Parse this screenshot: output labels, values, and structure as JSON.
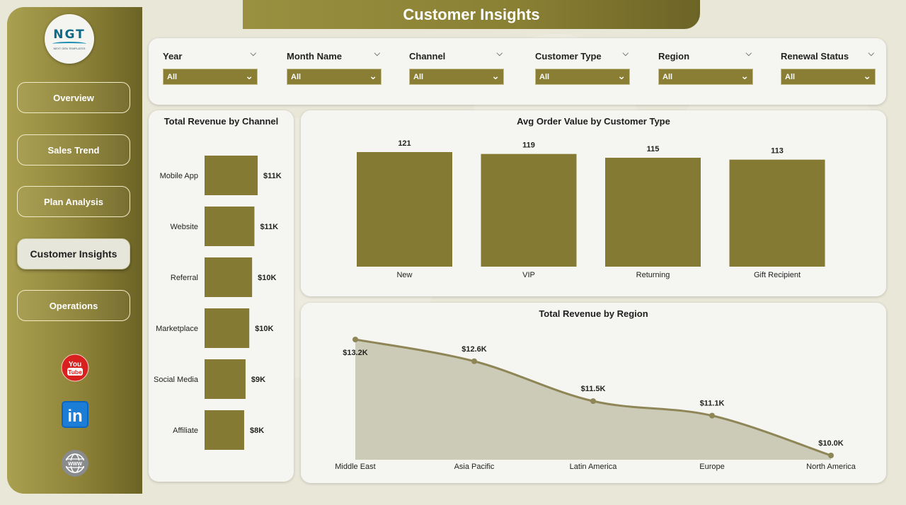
{
  "page": {
    "title": "Customer Insights"
  },
  "logo": {
    "mark": "NGT",
    "subtitle": "NEXT GEN TEMPLATES"
  },
  "sidebar": {
    "items": [
      {
        "label": "Overview",
        "active": false
      },
      {
        "label": "Sales Trend",
        "active": false
      },
      {
        "label": "Plan Analysis",
        "active": false
      },
      {
        "label": "Customer Insights",
        "active": true
      },
      {
        "label": "Operations",
        "active": false
      }
    ],
    "social": [
      {
        "icon": "youtube-icon",
        "text": "You Tube"
      },
      {
        "icon": "linkedin-icon",
        "text": "in"
      },
      {
        "icon": "website-globe-icon",
        "text": "WWW"
      }
    ]
  },
  "filters": [
    {
      "label": "Year",
      "value": "All"
    },
    {
      "label": "Month Name",
      "value": "All"
    },
    {
      "label": "Channel",
      "value": "All"
    },
    {
      "label": "Customer Type",
      "value": "All"
    },
    {
      "label": "Region",
      "value": "All"
    },
    {
      "label": "Renewal Status",
      "value": "All"
    }
  ],
  "colors": {
    "accent": "#857a33",
    "sidebar": "#8d8238",
    "area_fill": "#cccbb8",
    "line": "#8f8658"
  },
  "chart_data": [
    {
      "type": "bar",
      "orientation": "horizontal",
      "title": "Total Revenue by Channel",
      "categories": [
        "Mobile App",
        "Website",
        "Referral",
        "Marketplace",
        "Social Media",
        "Affiliate"
      ],
      "values": [
        11.4,
        10.7,
        10.2,
        9.6,
        8.8,
        8.5
      ],
      "value_labels": [
        "$11K",
        "$11K",
        "$10K",
        "$10K",
        "$9K",
        "$8K"
      ],
      "xlim": [
        0,
        12
      ]
    },
    {
      "type": "bar",
      "title": "Avg Order Value by Customer Type",
      "categories": [
        "New",
        "VIP",
        "Returning",
        "Gift Recipient"
      ],
      "values": [
        121,
        119,
        115,
        113
      ],
      "value_labels": [
        "121",
        "119",
        "115",
        "113"
      ],
      "ylim": [
        0,
        121
      ]
    },
    {
      "type": "area",
      "title": "Total Revenue by Region",
      "categories": [
        "Middle East",
        "Asia Pacific",
        "Latin America",
        "Europe",
        "North America"
      ],
      "values": [
        13.2,
        12.6,
        11.5,
        11.1,
        10.0
      ],
      "value_labels": [
        "$13.2K",
        "$12.6K",
        "$11.5K",
        "$11.1K",
        "$10.0K"
      ],
      "ylim": [
        10.0,
        13.2
      ]
    }
  ]
}
